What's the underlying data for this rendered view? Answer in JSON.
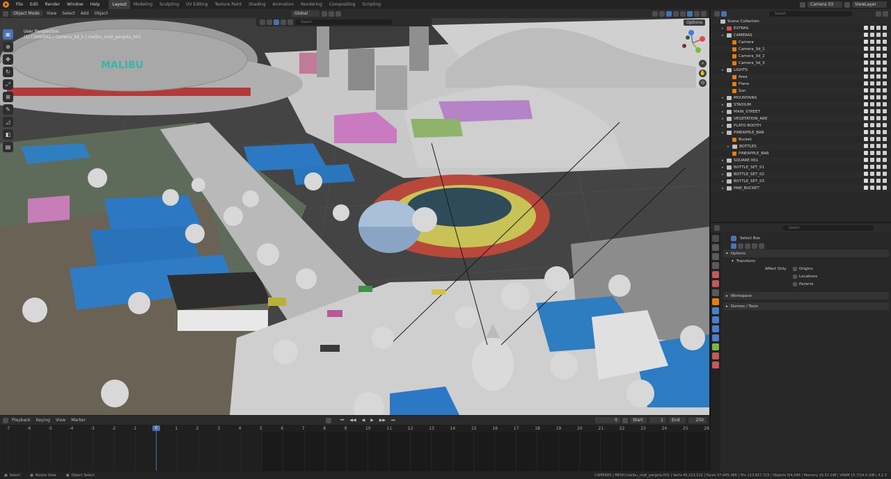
{
  "topbar": {
    "menus": [
      "File",
      "Edit",
      "Render",
      "Window",
      "Help"
    ],
    "workspaces": [
      "Layout",
      "Modeling",
      "Sculpting",
      "UV Editing",
      "Texture Paint",
      "Shading",
      "Animation",
      "Rendering",
      "Compositing",
      "Scripting"
    ],
    "active_workspace": "Layout",
    "scene_field": "Camera 03",
    "view_layer_field": "ViewLayer"
  },
  "viewport_header": {
    "mode": "Object Mode",
    "menus": [
      "View",
      "Select",
      "Add",
      "Object"
    ],
    "transform_orientation": "Global",
    "options_label": "Options",
    "search_placeholder": "Search"
  },
  "viewport_info": {
    "line1": "User Perspective",
    "line2": "(1) CAMERAS | Camera_3d_1 | malibu_mall_pergola_001"
  },
  "toolbar_icons": [
    "select-box-icon",
    "cursor-icon",
    "move-icon",
    "rotate-icon",
    "scale-icon",
    "transform-icon",
    "annotate-icon",
    "measure-icon",
    "add-cube-icon",
    "extrude-icon"
  ],
  "timeline_header": {
    "menus": [
      "Playback",
      "Keying",
      "View",
      "Marker"
    ],
    "current_frame": "0",
    "start_label": "Start",
    "start_value": "1",
    "end_label": "End",
    "end_value": "250"
  },
  "timeline_ticks": [
    "-7",
    "-6",
    "-5",
    "-4",
    "-3",
    "-2",
    "-1",
    "0",
    "1",
    "2",
    "3",
    "4",
    "5",
    "6",
    "7",
    "8",
    "9",
    "10",
    "11",
    "12",
    "13",
    "14",
    "15",
    "16",
    "17",
    "18",
    "19",
    "20",
    "21",
    "22",
    "23",
    "24",
    "25",
    "26"
  ],
  "statusbar": {
    "left": [
      "Select",
      "Rotate View",
      "Object Select"
    ],
    "right": "CAMERAS | MESH.malibu_mall_pergola.001 | Verts 45,213,122 | Faces 57,645,386 | Tris 113,827,715 | Objects 0/4,046 | Memory 15.52 GiB | VRAM 15.7/24.0 GiB | 4.2.3"
  },
  "outliner": {
    "search_placeholder": "Search",
    "root": "Scene Collection",
    "rows": [
      {
        "label": "EXTRAS",
        "indent": 1,
        "type": "collection",
        "color": "#e24b4b"
      },
      {
        "label": "CAMERAS",
        "indent": 1,
        "type": "collection",
        "color": "#bfbfbf"
      },
      {
        "label": "Camera",
        "indent": 2,
        "type": "camera",
        "color": "#e87d0d"
      },
      {
        "label": "Camera_3d_1",
        "indent": 2,
        "type": "camera",
        "color": "#e87d0d"
      },
      {
        "label": "Camera_3d_2",
        "indent": 2,
        "type": "camera",
        "color": "#e87d0d"
      },
      {
        "label": "Camera_3d_3",
        "indent": 2,
        "type": "camera",
        "color": "#e87d0d"
      },
      {
        "label": "LIGHTS",
        "indent": 1,
        "type": "collection",
        "color": "#bfbfbf"
      },
      {
        "label": "Area",
        "indent": 2,
        "type": "light",
        "color": "#e87d0d"
      },
      {
        "label": "Plane",
        "indent": 2,
        "type": "mesh",
        "color": "#e87d0d"
      },
      {
        "label": "Sun",
        "indent": 2,
        "type": "light",
        "color": "#e87d0d"
      },
      {
        "label": "MOUNTAINS",
        "indent": 1,
        "type": "collection",
        "color": "#bfbfbf"
      },
      {
        "label": "STADIUM",
        "indent": 1,
        "type": "collection",
        "color": "#bfbfbf"
      },
      {
        "label": "MAIN_STREET",
        "indent": 1,
        "type": "collection",
        "color": "#bfbfbf"
      },
      {
        "label": "VEGETATION_ARE",
        "indent": 1,
        "type": "collection",
        "color": "#bfbfbf"
      },
      {
        "label": "PLATO BOOTH",
        "indent": 1,
        "type": "collection",
        "color": "#bfbfbf"
      },
      {
        "label": "PINEAPPLE_BAR",
        "indent": 1,
        "type": "collection",
        "color": "#bfbfbf"
      },
      {
        "label": "Bucket",
        "indent": 2,
        "type": "mesh",
        "color": "#e87d0d"
      },
      {
        "label": "BOTTLES",
        "indent": 2,
        "type": "collection",
        "color": "#bfbfbf"
      },
      {
        "label": "PINEAPPLE_BAR",
        "indent": 2,
        "type": "mesh",
        "color": "#e87d0d"
      },
      {
        "label": "SQUARE 001",
        "indent": 1,
        "type": "collection",
        "color": "#bfbfbf"
      },
      {
        "label": "BOTTLE_SET_01",
        "indent": 1,
        "type": "collection",
        "color": "#bfbfbf"
      },
      {
        "label": "BOTTLE_SET_02",
        "indent": 1,
        "type": "collection",
        "color": "#bfbfbf"
      },
      {
        "label": "BOTTLE_SET_03",
        "indent": 1,
        "type": "collection",
        "color": "#bfbfbf"
      },
      {
        "label": "PAW_BUCKET",
        "indent": 1,
        "type": "collection",
        "color": "#bfbfbf"
      }
    ]
  },
  "properties": {
    "search_placeholder": "Search",
    "tool_name": "Select Box",
    "options_label": "Options",
    "transform_label": "Transform",
    "affect_only_label": "Affect Only",
    "affect_items": [
      "Origins",
      "Locations",
      "Parents"
    ],
    "workspace_label": "Workspace",
    "overlay_label": "Gizmos / Tools"
  }
}
